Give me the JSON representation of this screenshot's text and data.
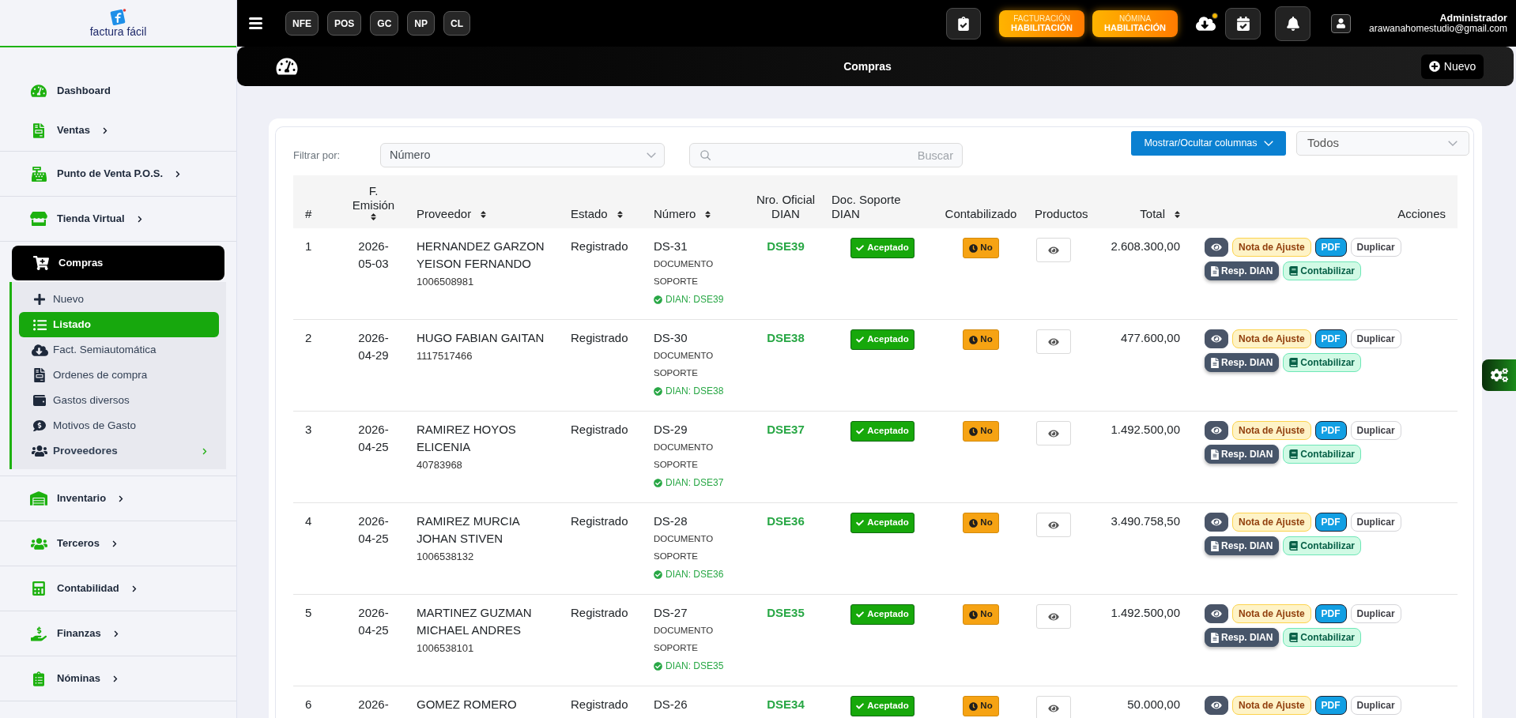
{
  "logo": {
    "text": "factura fácil"
  },
  "topbar": {
    "quick_buttons": [
      "NFE",
      "POS",
      "GC",
      "NP",
      "CL"
    ],
    "badges": [
      {
        "caption": "FACTURACIÓN",
        "label": "HABILITACIÓN"
      },
      {
        "caption": "NÓMINA",
        "label": "HABILITACIÓN"
      }
    ],
    "user": {
      "name": "Administrador",
      "email": "arawanahomestudio@gmail.com"
    }
  },
  "page_header": {
    "title": "Compras",
    "new_button": "Nuevo"
  },
  "sidebar": {
    "items": [
      {
        "label": "Dashboard",
        "expandable": false,
        "expanded": false,
        "selected": false
      },
      {
        "label": "Ventas",
        "expandable": true,
        "expanded": false,
        "selected": false
      },
      {
        "label": "Punto de Venta P.O.S.",
        "expandable": true,
        "expanded": false,
        "selected": false
      },
      {
        "label": "Tienda Virtual",
        "expandable": true,
        "expanded": false,
        "selected": false
      },
      {
        "label": "Compras",
        "expandable": true,
        "expanded": true,
        "selected": true,
        "children": [
          {
            "label": "Nuevo",
            "expandable": false,
            "selected": false
          },
          {
            "label": "Listado",
            "expandable": false,
            "selected": true
          },
          {
            "label": "Fact. Semiautomática",
            "expandable": false,
            "selected": false
          },
          {
            "label": "Ordenes de compra",
            "expandable": false,
            "selected": false
          },
          {
            "label": "Gastos diversos",
            "expandable": false,
            "selected": false
          },
          {
            "label": "Motivos de Gasto",
            "expandable": false,
            "selected": false
          },
          {
            "label": "Proveedores",
            "expandable": true,
            "selected": false
          }
        ]
      },
      {
        "label": "Inventario",
        "expandable": true,
        "expanded": false,
        "selected": false
      },
      {
        "label": "Terceros",
        "expandable": true,
        "expanded": false,
        "selected": false
      },
      {
        "label": "Contabilidad",
        "expandable": true,
        "expanded": false,
        "selected": false
      },
      {
        "label": "Finanzas",
        "expandable": true,
        "expanded": false,
        "selected": false
      },
      {
        "label": "Nóminas",
        "expandable": true,
        "expanded": false,
        "selected": false
      }
    ]
  },
  "filters": {
    "label": "Filtrar por:",
    "field_select": "Número",
    "search_placeholder": "Buscar",
    "columns_button": "Mostrar/Ocultar columnas",
    "status_select": "Todos"
  },
  "table": {
    "columns": [
      {
        "label": "#",
        "sortable": false
      },
      {
        "label": "F. Emisión",
        "sortable": true
      },
      {
        "label": "Proveedor",
        "sortable": true
      },
      {
        "label": "Estado",
        "sortable": true
      },
      {
        "label": "Número",
        "sortable": true
      },
      {
        "label": "Nro. Oficial DIAN",
        "sortable": false
      },
      {
        "label": "Doc. Soporte DIAN",
        "sortable": false
      },
      {
        "label": "Contabilizado",
        "sortable": false
      },
      {
        "label": "Productos",
        "sortable": false
      },
      {
        "label": "Total",
        "sortable": true
      },
      {
        "label": "Acciones",
        "sortable": false
      }
    ],
    "rows": [
      {
        "index": "1",
        "date": "2026-05-03",
        "supplier": "HERNANDEZ GARZON YEISON FERNANDO",
        "supplier_id": "1006508981",
        "status": "Registrado",
        "number": "DS-31",
        "doc_type": "DOCUMENTO SOPORTE",
        "dian_ref": "DIAN: DSE39",
        "official_number": "DSE39",
        "doc_support": "Aceptado",
        "accounted": "No",
        "total": "2.608.300,00",
        "actions": [
          {
            "kind": "view"
          },
          {
            "kind": "adjust",
            "label": "Nota de Ajuste"
          },
          {
            "kind": "pdf",
            "label": "PDF"
          },
          {
            "kind": "duplicate",
            "label": "Duplicar"
          },
          {
            "kind": "response",
            "label": "Resp. DIAN"
          },
          {
            "kind": "accounting",
            "label": "Contabilizar"
          }
        ]
      },
      {
        "index": "2",
        "date": "2026-04-29",
        "supplier": "HUGO FABIAN GAITAN",
        "supplier_id": "1117517466",
        "status": "Registrado",
        "number": "DS-30",
        "doc_type": "DOCUMENTO SOPORTE",
        "dian_ref": "DIAN: DSE38",
        "official_number": "DSE38",
        "doc_support": "Aceptado",
        "accounted": "No",
        "total": "477.600,00",
        "actions": [
          {
            "kind": "view"
          },
          {
            "kind": "adjust",
            "label": "Nota de Ajuste"
          },
          {
            "kind": "pdf",
            "label": "PDF"
          },
          {
            "kind": "duplicate",
            "label": "Duplicar"
          },
          {
            "kind": "response",
            "label": "Resp. DIAN"
          },
          {
            "kind": "accounting",
            "label": "Contabilizar"
          }
        ]
      },
      {
        "index": "3",
        "date": "2026-04-25",
        "supplier": "RAMIREZ HOYOS ELICENIA",
        "supplier_id": "40783968",
        "status": "Registrado",
        "number": "DS-29",
        "doc_type": "DOCUMENTO SOPORTE",
        "dian_ref": "DIAN: DSE37",
        "official_number": "DSE37",
        "doc_support": "Aceptado",
        "accounted": "No",
        "total": "1.492.500,00",
        "actions": [
          {
            "kind": "view"
          },
          {
            "kind": "adjust",
            "label": "Nota de Ajuste"
          },
          {
            "kind": "pdf",
            "label": "PDF"
          },
          {
            "kind": "duplicate",
            "label": "Duplicar"
          },
          {
            "kind": "response",
            "label": "Resp. DIAN"
          },
          {
            "kind": "accounting",
            "label": "Contabilizar"
          }
        ]
      },
      {
        "index": "4",
        "date": "2026-04-25",
        "supplier": "RAMIREZ MURCIA JOHAN STIVEN",
        "supplier_id": "1006538132",
        "status": "Registrado",
        "number": "DS-28",
        "doc_type": "DOCUMENTO SOPORTE",
        "dian_ref": "DIAN: DSE36",
        "official_number": "DSE36",
        "doc_support": "Aceptado",
        "accounted": "No",
        "total": "3.490.758,50",
        "actions": [
          {
            "kind": "view"
          },
          {
            "kind": "adjust",
            "label": "Nota de Ajuste"
          },
          {
            "kind": "pdf",
            "label": "PDF"
          },
          {
            "kind": "duplicate",
            "label": "Duplicar"
          },
          {
            "kind": "response",
            "label": "Resp. DIAN"
          },
          {
            "kind": "accounting",
            "label": "Contabilizar"
          }
        ]
      },
      {
        "index": "5",
        "date": "2026-04-25",
        "supplier": "MARTINEZ GUZMAN MICHAEL ANDRES",
        "supplier_id": "1006538101",
        "status": "Registrado",
        "number": "DS-27",
        "doc_type": "DOCUMENTO SOPORTE",
        "dian_ref": "DIAN: DSE35",
        "official_number": "DSE35",
        "doc_support": "Aceptado",
        "accounted": "No",
        "total": "1.492.500,00",
        "actions": [
          {
            "kind": "view"
          },
          {
            "kind": "adjust",
            "label": "Nota de Ajuste"
          },
          {
            "kind": "pdf",
            "label": "PDF"
          },
          {
            "kind": "duplicate",
            "label": "Duplicar"
          },
          {
            "kind": "response",
            "label": "Resp. DIAN"
          },
          {
            "kind": "accounting",
            "label": "Contabilizar"
          }
        ]
      },
      {
        "index": "6",
        "date": "2026-",
        "supplier": "GOMEZ ROMERO",
        "status": "Registrado",
        "number": "DS-26",
        "official_number": "DSE34",
        "doc_support": "Aceptado",
        "accounted": "No",
        "total": "50.000,00",
        "actions": [
          {
            "kind": "view"
          },
          {
            "kind": "adjust",
            "label": "Nota de Ajuste"
          },
          {
            "kind": "pdf",
            "label": "PDF"
          },
          {
            "kind": "duplicate",
            "label": "Duplicar"
          }
        ]
      }
    ]
  }
}
